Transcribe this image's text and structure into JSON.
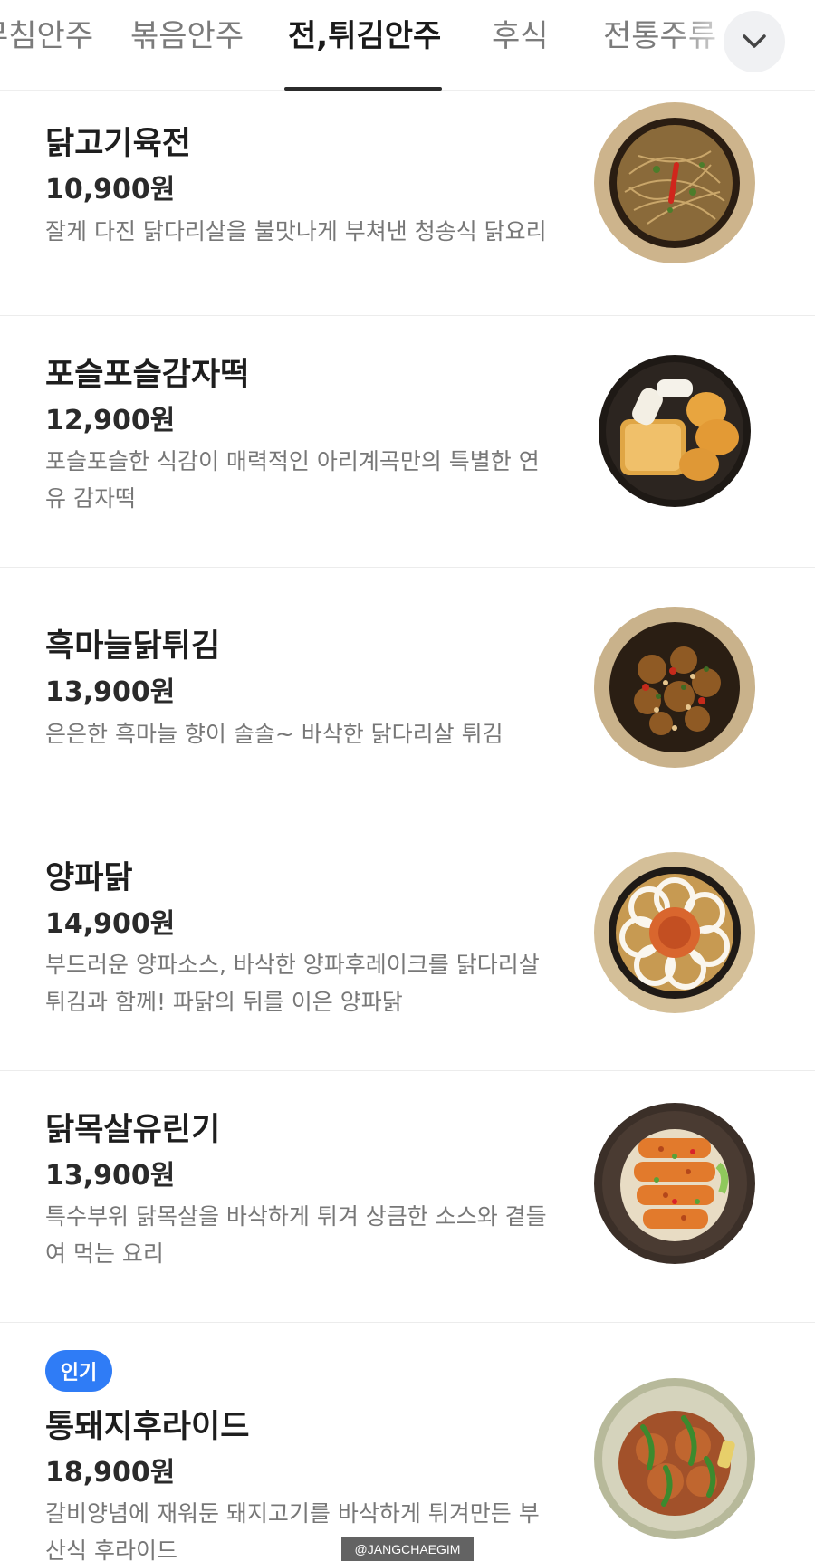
{
  "tabs": [
    {
      "label": "무침안주",
      "active": false
    },
    {
      "label": "볶음안주",
      "active": false
    },
    {
      "label": "전,튀김안주",
      "active": true
    },
    {
      "label": "후식",
      "active": false
    },
    {
      "label": "전통주류",
      "active": false
    }
  ],
  "expand_icon": "chevron-down-icon",
  "menu": [
    {
      "name": "닭고기육전",
      "price": "10,900원",
      "desc": "잘게 다진 닭다리살을 불맛나게 부쳐낸 청송식 닭요리",
      "badge": ""
    },
    {
      "name": "포슬포슬감자떡",
      "price": "12,900원",
      "desc": "포슬포슬한 식감이 매력적인 아리계곡만의 특별한 연유 감자떡",
      "badge": ""
    },
    {
      "name": "흑마늘닭튀김",
      "price": "13,900원",
      "desc": "은은한 흑마늘 향이 솔솔~ 바삭한 닭다리살 튀김",
      "badge": ""
    },
    {
      "name": "양파닭",
      "price": "14,900원",
      "desc": "부드러운 양파소스, 바삭한 양파후레이크를 닭다리살 튀김과 함께! 파닭의 뒤를 이은 양파닭",
      "badge": ""
    },
    {
      "name": "닭목살유린기",
      "price": "13,900원",
      "desc": "특수부위 닭목살을 바삭하게 튀겨 상큼한 소스와 곁들여 먹는 요리",
      "badge": ""
    },
    {
      "name": "통돼지후라이드",
      "price": "18,900원",
      "desc": "갈비양념에 재워둔 돼지고기를 바삭하게 튀겨만든 부산식 후라이드",
      "badge": "인기"
    }
  ],
  "watermark": "@JANGCHAEGIM",
  "colors": {
    "accent_badge": "#2f7cf6",
    "active_tab": "#1a1a1a",
    "inactive_tab": "#7b7b7b"
  }
}
